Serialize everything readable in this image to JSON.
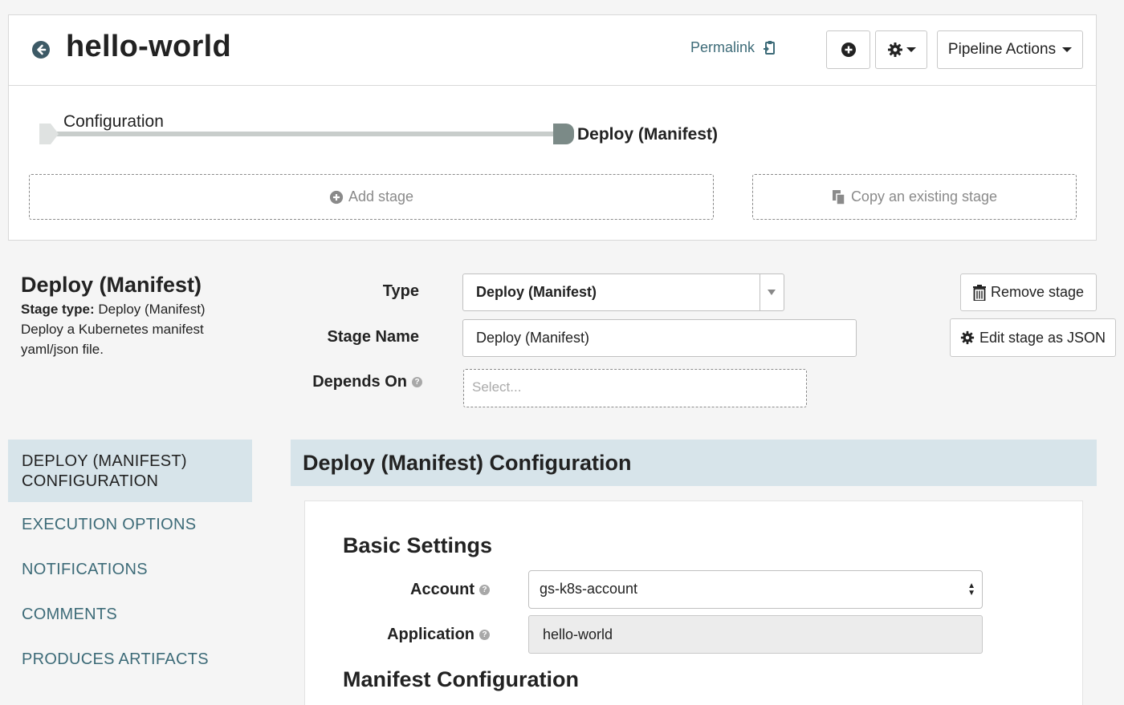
{
  "pipeline": {
    "title": "hello-world",
    "permalink_label": "Permalink",
    "actions_label": "Pipeline Actions"
  },
  "graph": {
    "stages": [
      "Configuration",
      "Deploy (Manifest)"
    ],
    "add_stage_label": "Add stage",
    "copy_stage_label": "Copy an existing stage"
  },
  "stage": {
    "title": "Deploy (Manifest)",
    "type_prefix": "Stage type:",
    "type_value": "Deploy (Manifest)",
    "description": "Deploy a Kubernetes manifest yaml/json file."
  },
  "form": {
    "type_label": "Type",
    "type_value": "Deploy (Manifest)",
    "name_label": "Stage Name",
    "name_value": "Deploy (Manifest)",
    "depends_label": "Depends On",
    "depends_placeholder": "Select..."
  },
  "side_buttons": {
    "remove_label": "Remove stage",
    "edit_json_label": "Edit stage as JSON"
  },
  "nav": {
    "items": [
      "DEPLOY (MANIFEST) CONFIGURATION",
      "EXECUTION OPTIONS",
      "NOTIFICATIONS",
      "COMMENTS",
      "PRODUCES ARTIFACTS"
    ],
    "active_index": 0
  },
  "config": {
    "title": "Deploy (Manifest) Configuration",
    "basic_settings_heading": "Basic Settings",
    "account_label": "Account",
    "account_value": "gs-k8s-account",
    "application_label": "Application",
    "application_value": "hello-world",
    "manifest_heading": "Manifest Configuration"
  },
  "colors": {
    "link": "#3d6b78",
    "panel_highlight": "#d7e4ea",
    "page_background": "#f5f5f5"
  },
  "icons": {
    "back": "circle-arrow-left-icon",
    "permalink": "clipboard-icon",
    "add": "plus-circle-icon",
    "settings": "gear-icon",
    "add_stage": "plus-circle-icon",
    "copy_stage": "copy-icon",
    "remove": "trash-icon",
    "edit_json": "gear-icon",
    "help": "question-circle-icon"
  }
}
